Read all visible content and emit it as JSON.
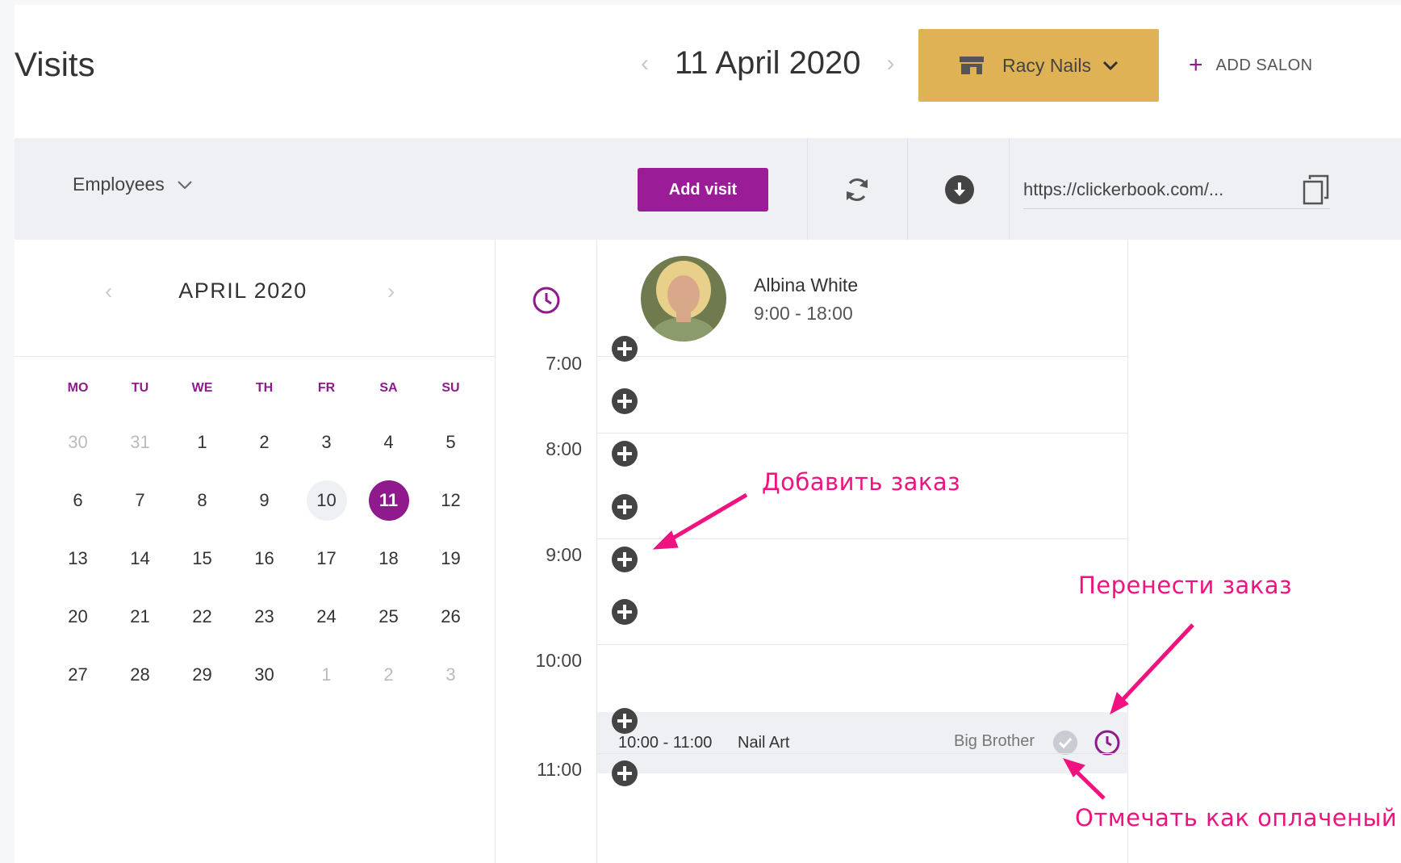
{
  "header": {
    "title": "Visits",
    "date": "11 April 2020",
    "salon": "Racy Nails",
    "add_salon": "ADD SALON"
  },
  "toolbar": {
    "employees_label": "Employees",
    "add_visit": "Add visit",
    "booking_url": "https://clickerbook.com/..."
  },
  "calendar": {
    "month": "APRIL 2020",
    "weekdays": [
      "MO",
      "TU",
      "WE",
      "TH",
      "FR",
      "SA",
      "SU"
    ],
    "weeks": [
      [
        "30",
        "31",
        "1",
        "2",
        "3",
        "4",
        "5"
      ],
      [
        "6",
        "7",
        "8",
        "9",
        "10",
        "11",
        "12"
      ],
      [
        "13",
        "14",
        "15",
        "16",
        "17",
        "18",
        "19"
      ],
      [
        "20",
        "21",
        "22",
        "23",
        "24",
        "25",
        "26"
      ],
      [
        "27",
        "28",
        "29",
        "30",
        "1",
        "2",
        "3"
      ]
    ],
    "today": "10",
    "selected": "11"
  },
  "schedule": {
    "times": [
      "7:00",
      "8:00",
      "9:00",
      "10:00",
      "11:00"
    ],
    "employee": {
      "name": "Albina White",
      "hours": "9:00 - 18:00"
    },
    "booking": {
      "time": "10:00 - 11:00",
      "service": "Nail Art",
      "client": "Big Brother"
    }
  },
  "annotations": {
    "add_order": "Добавить заказ",
    "move_order": "Перенести заказ",
    "mark_paid": "Отмечать как оплаченый"
  },
  "colors": {
    "accent": "#8e1a8e",
    "salon_button": "#dfb355",
    "annotation": "#f0127f"
  }
}
